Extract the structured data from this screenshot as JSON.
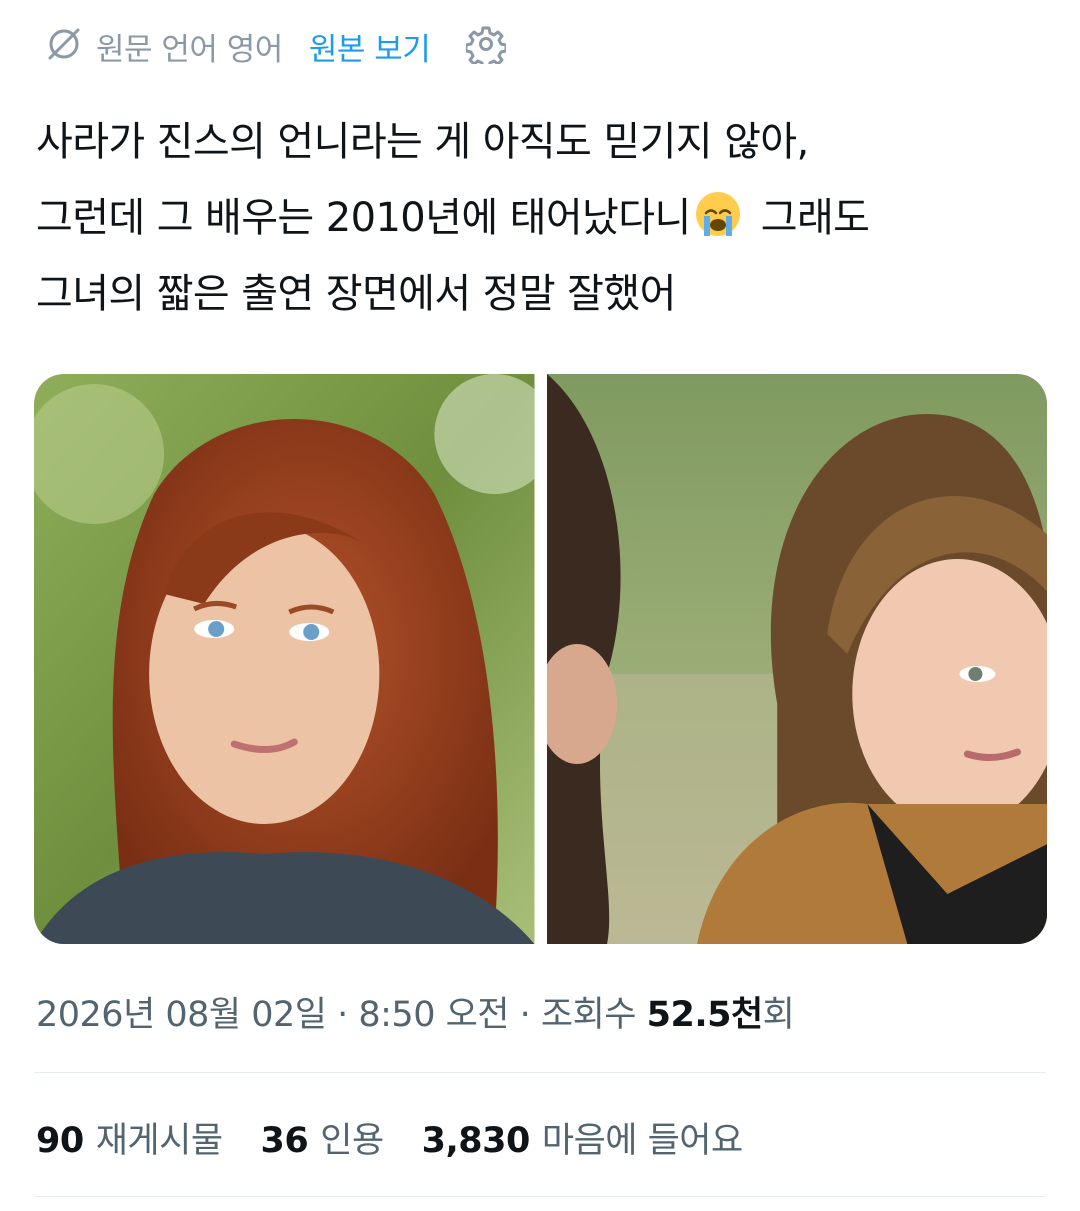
{
  "translate_bar": {
    "source_language": "원문 언어 영어",
    "view_original": "원본 보기"
  },
  "tweet": {
    "lines": [
      "사라가 진스의 언니라는 게 아직도 믿기지 않아,",
      "그런데 그 배우는 2010년에 태어났다니",
      " 그래도",
      "그녀의 짧은 출연 장면에서 정말 잘했어"
    ],
    "emoji": "loudly-crying-face"
  },
  "media": {
    "photos": [
      "photo-left-red-haired-woman",
      "photo-right-woman-with-bangs"
    ]
  },
  "meta": {
    "datetime": "2026년 08월 02일 · 8:50 오전 · 조회수 ",
    "views": "52.5천",
    "views_suffix": "회"
  },
  "stats": {
    "retweets": {
      "count": "90",
      "label": "재게시물"
    },
    "quotes": {
      "count": "36",
      "label": "인용"
    },
    "likes": {
      "count": "3,830",
      "label": "마음에 들어요"
    }
  },
  "colors": {
    "link": "#1d9bf0",
    "muted": "#536471",
    "text": "#0f1419"
  }
}
